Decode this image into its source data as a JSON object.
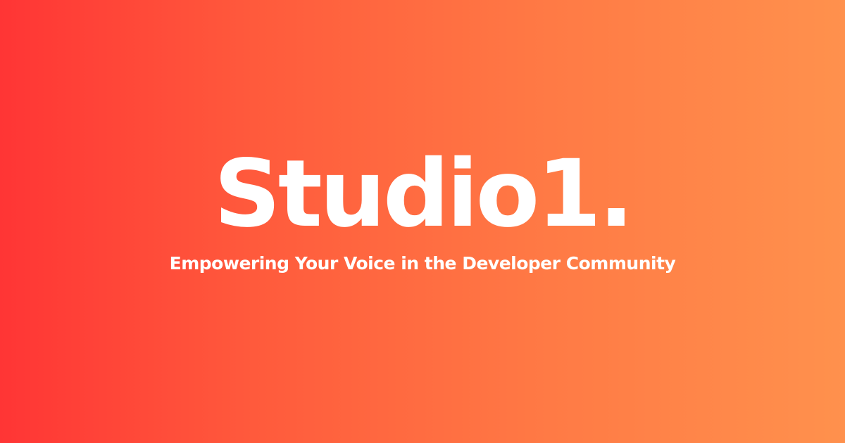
{
  "brand": {
    "name": "Studio1."
  },
  "tagline": "Empowering Your Voice in the Developer Community",
  "colors": {
    "gradient_start": "#ff3535",
    "gradient_end": "#ff914d",
    "text": "#ffffff"
  }
}
